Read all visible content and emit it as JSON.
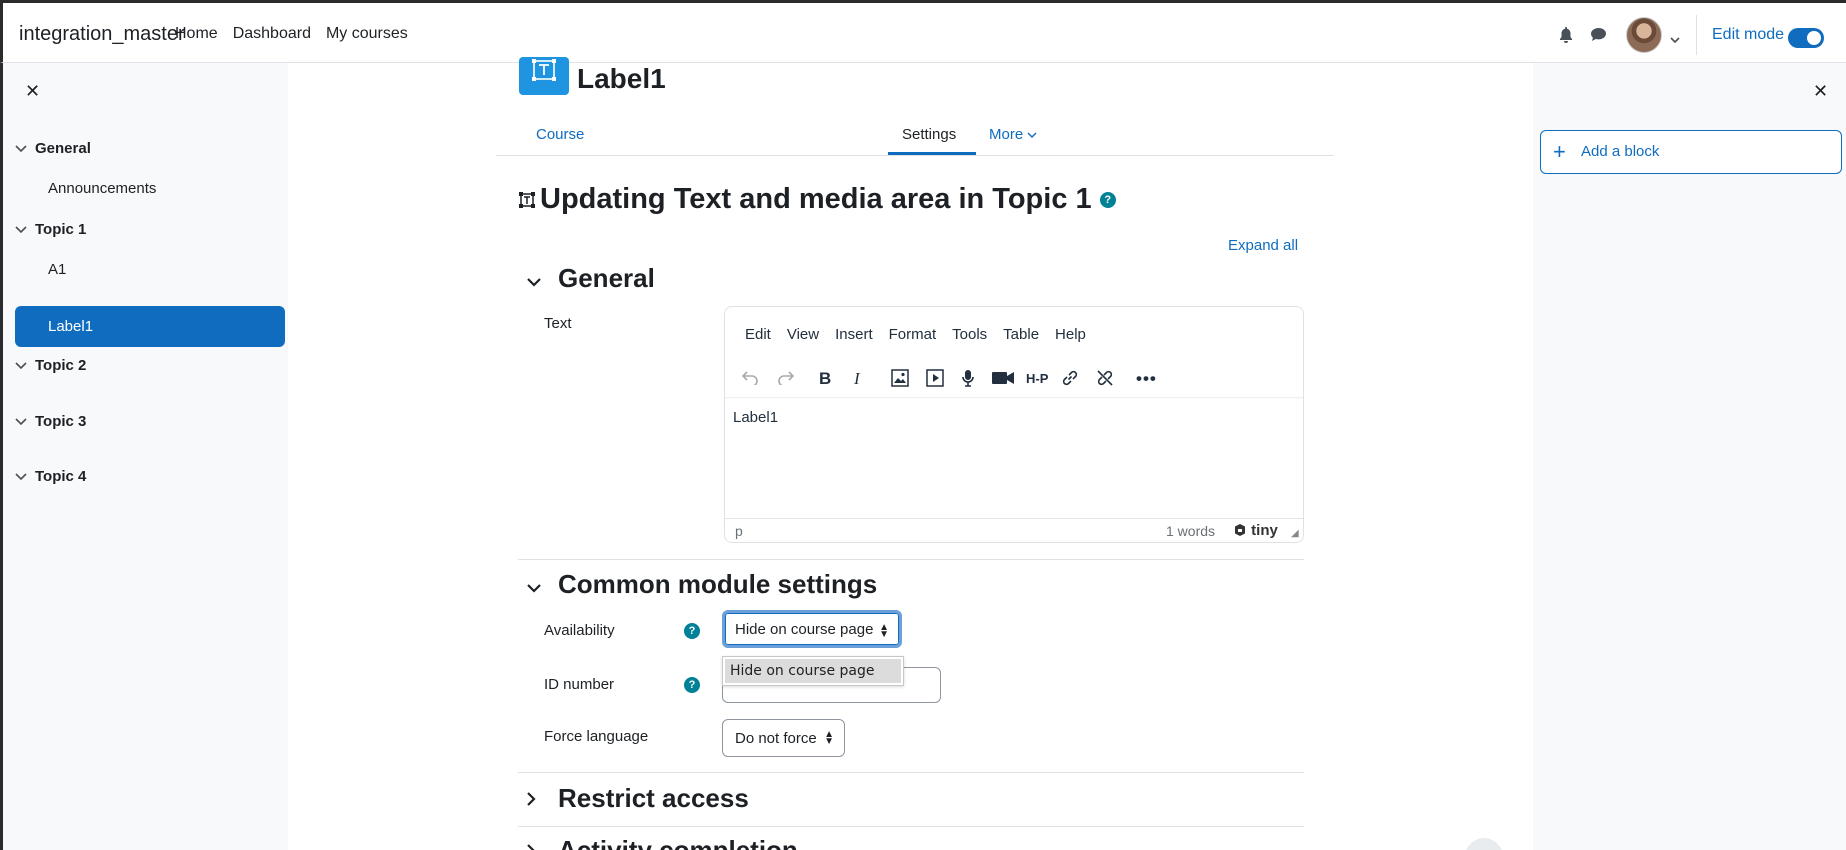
{
  "navbar": {
    "brand": "integration_master",
    "links": [
      "Home",
      "Dashboard",
      "My courses"
    ],
    "edit_mode_label": "Edit mode",
    "edit_mode_on": true,
    "accent": "#0f6cbf"
  },
  "course_index": {
    "close_icon": "close-icon",
    "sections": [
      {
        "title": "General",
        "items": [
          "Announcements"
        ]
      },
      {
        "title": "Topic 1",
        "items": [
          "A1",
          "Label1"
        ],
        "active_item": "Label1"
      },
      {
        "title": "Topic 2",
        "items": []
      },
      {
        "title": "Topic 3",
        "items": []
      },
      {
        "title": "Topic 4",
        "items": []
      }
    ]
  },
  "header": {
    "activity_name": "Label1",
    "tabs": [
      "Course",
      "Settings",
      "More"
    ],
    "active_tab": "Settings"
  },
  "page_title": "Updating Text and media area in Topic 1",
  "help_glyph": "?",
  "expand_all": "Expand all",
  "general_section": {
    "title": "General",
    "text_label": "Text",
    "editor": {
      "menubar": [
        "Edit",
        "View",
        "Insert",
        "Format",
        "Tools",
        "Table",
        "Help"
      ],
      "content": "Label1",
      "status_path": "p",
      "word_count": "1 words",
      "brand": "tiny"
    }
  },
  "common_module": {
    "title": "Common module settings",
    "availability_label": "Availability",
    "availability_value": "Hide on course page",
    "availability_dropdown_options": [
      "Hide on course page"
    ],
    "id_number_label": "ID number",
    "id_number_value": "",
    "force_language_label": "Force language",
    "force_language_value": "Do not force"
  },
  "collapsed_sections": [
    "Restrict access",
    "Activity completion"
  ],
  "block_drawer": {
    "add_block_label": "Add a block"
  }
}
